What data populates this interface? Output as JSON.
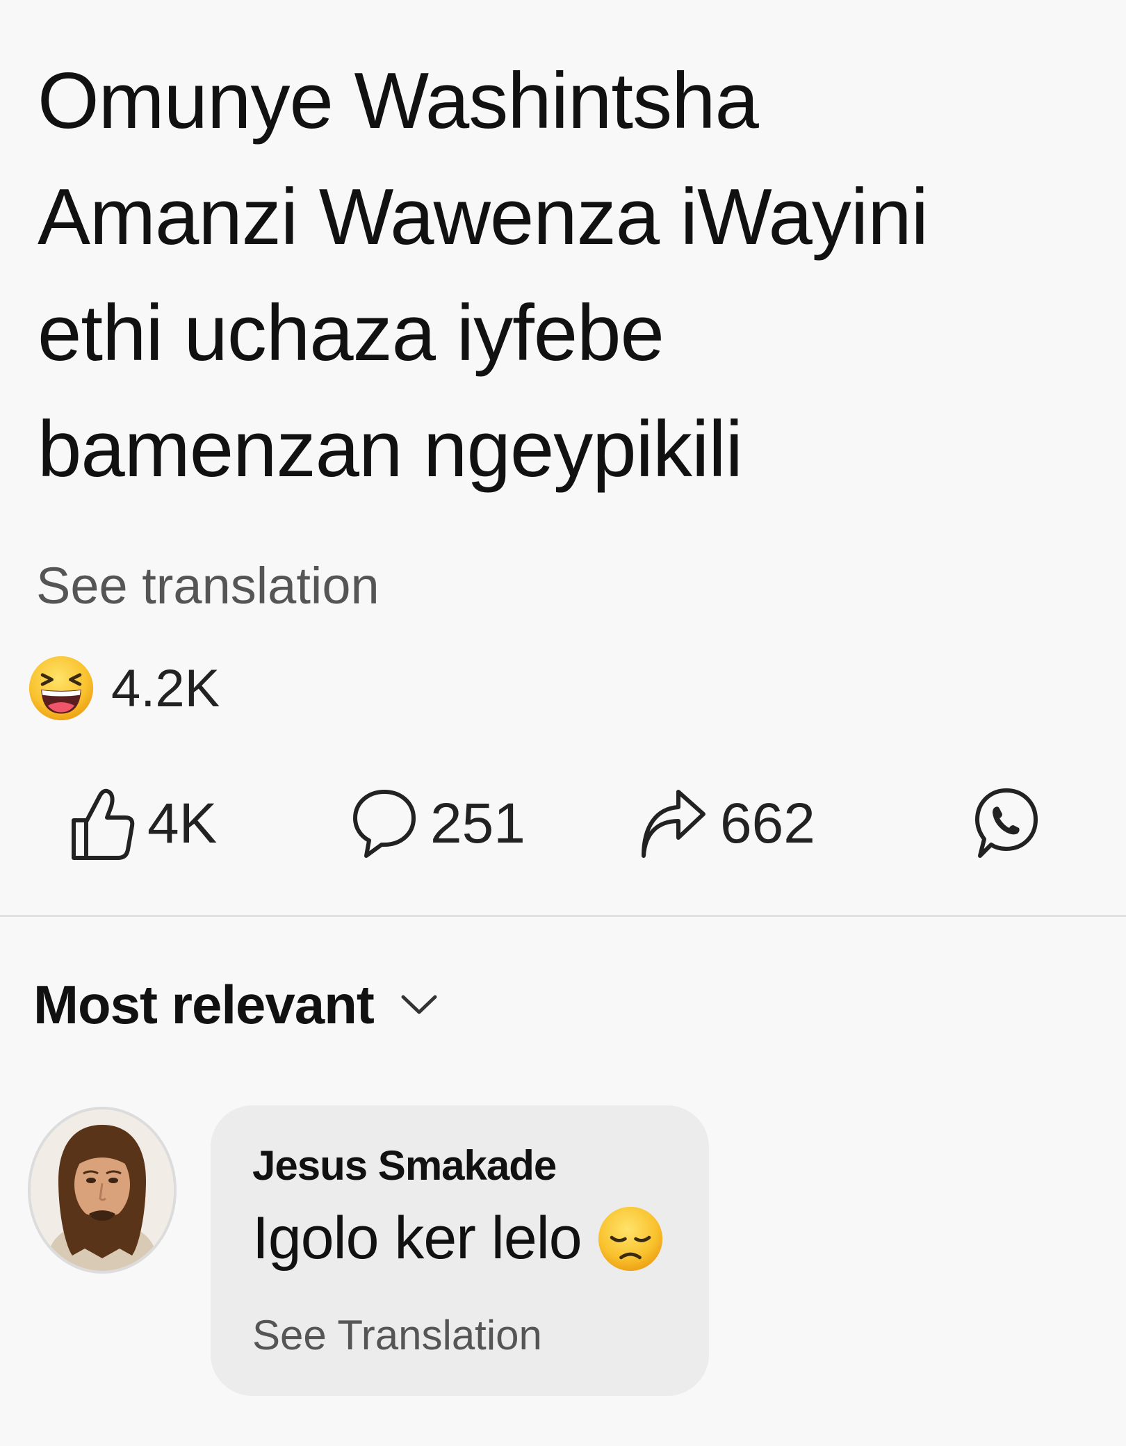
{
  "post": {
    "text_lines": [
      "Omunye Washintsha",
      "Amanzi Wawenza iWayini",
      "ethi uchaza iyfebe",
      "bamenzan ngeypikili"
    ],
    "see_translation": "See translation"
  },
  "reactions": {
    "icon": "laughing-face-icon",
    "count": "4.2K"
  },
  "actions": {
    "like": {
      "icon": "thumbs-up-icon",
      "count": "4K"
    },
    "comment": {
      "icon": "comment-bubble-icon",
      "count": "251"
    },
    "share": {
      "icon": "share-arrow-icon",
      "count": "662"
    },
    "whatsapp": {
      "icon": "whatsapp-icon"
    }
  },
  "comments_section": {
    "sort_label": "Most relevant",
    "sort_icon": "chevron-down-icon",
    "comment": {
      "author": "Jesus Smakade",
      "text": "Igolo ker lelo",
      "emoji": "disappointed-face-icon",
      "see_translation": "See Translation"
    }
  },
  "colors": {
    "background": "#f8f8f8",
    "text": "#111111",
    "muted_text": "#555555",
    "bubble": "#ececed",
    "divider": "#e2e2e2",
    "emoji_yellow": "#f7c02b"
  }
}
